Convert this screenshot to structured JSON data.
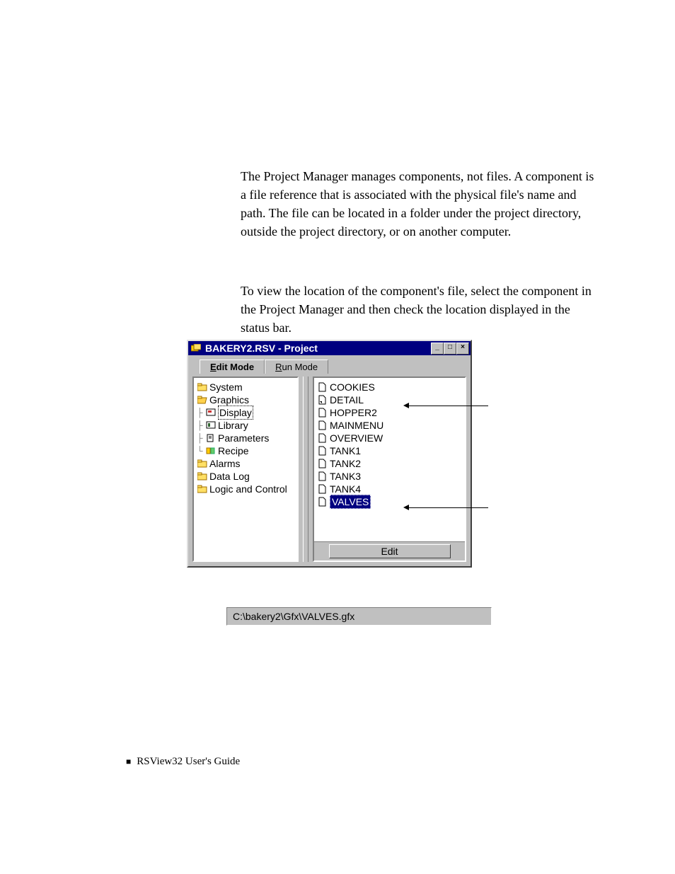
{
  "paragraphs": {
    "p1": "The Project Manager manages components, not files. A component is a file reference that is associated with the physical file's name and path. The file can be located in a folder under the project directory, outside the project directory, or on another computer.",
    "p2": "To view the location of the component's file, select the component in the Project Manager and then check the location displayed in the status bar."
  },
  "window": {
    "title": "BAKERY2.RSV - Project",
    "tabs": {
      "edit": "Edit Mode",
      "run": "Run Mode"
    },
    "tree": {
      "system": "System",
      "graphics": "Graphics",
      "display": "Display",
      "library": "Library",
      "parameters": "Parameters",
      "recipe": "Recipe",
      "alarms": "Alarms",
      "datalog": "Data Log",
      "logic": "Logic and Control"
    },
    "list": {
      "items": [
        "COOKIES",
        "DETAIL",
        "HOPPER2",
        "MAINMENU",
        "OVERVIEW",
        "TANK1",
        "TANK2",
        "TANK3",
        "TANK4",
        "VALVES"
      ],
      "selected": "VALVES"
    },
    "edit_button": "Edit"
  },
  "statusbar": {
    "path": "C:\\bakery2\\Gfx\\VALVES.gfx"
  },
  "footer": {
    "text": "RSView32  User's Guide"
  }
}
